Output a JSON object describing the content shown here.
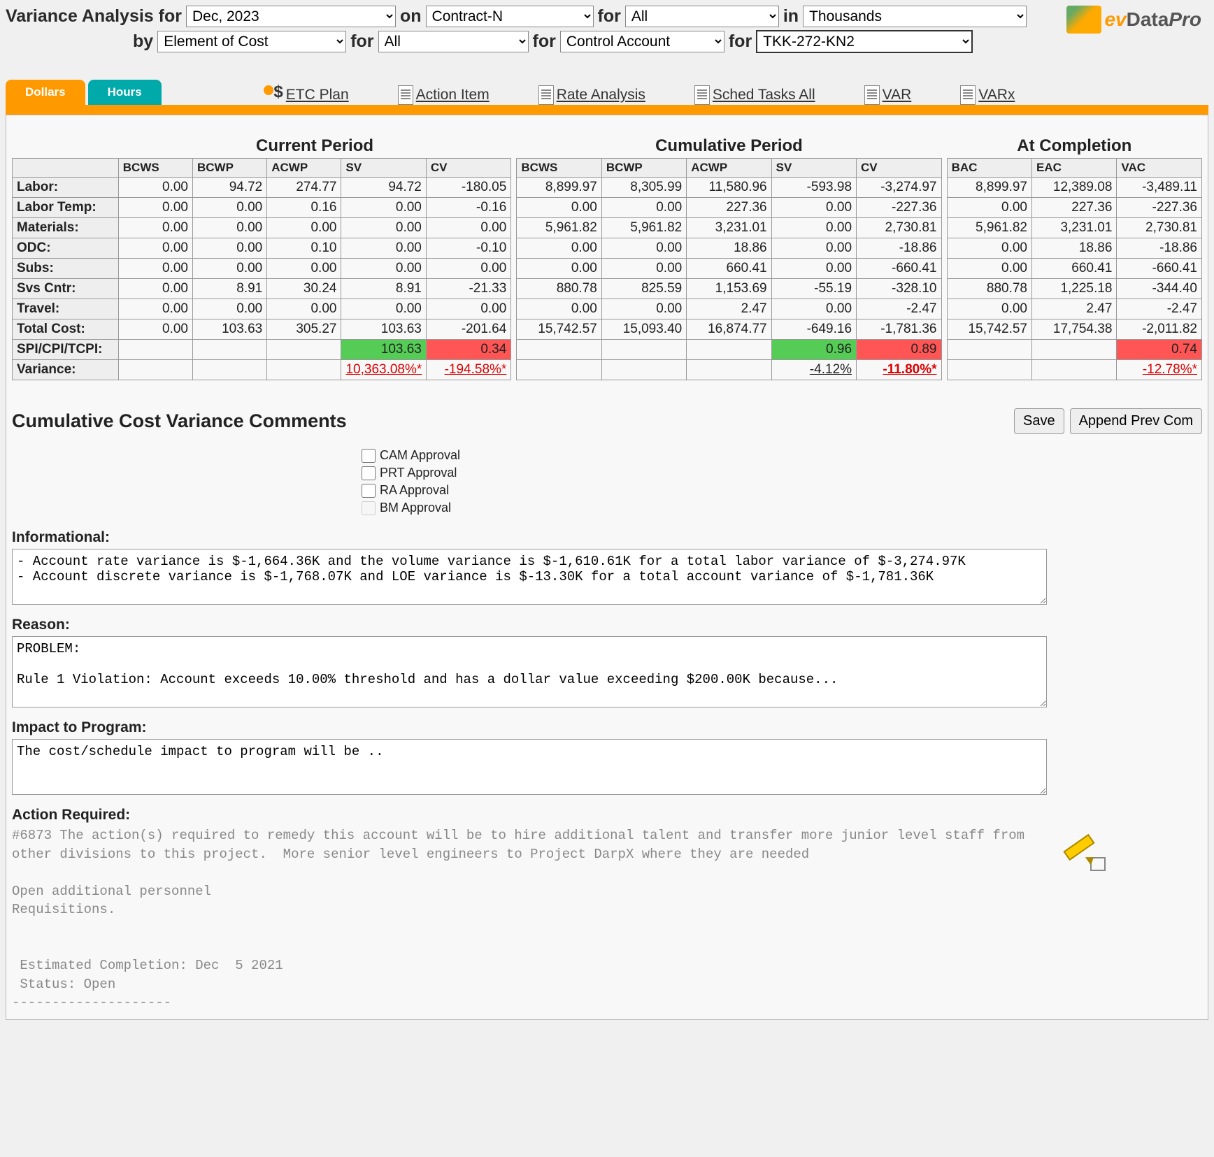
{
  "header": {
    "title_prefix": "Variance Analysis for",
    "month": "Dec, 2023",
    "on_lbl": "on",
    "contract": "Contract-N",
    "for1_lbl": "for",
    "all1": "All",
    "in_lbl": "in",
    "units": "Thousands",
    "by_lbl": "by",
    "eoc": "Element of Cost",
    "for2_lbl": "for",
    "all2": "All",
    "for3_lbl": "for",
    "ca": "Control Account",
    "for4_lbl": "for",
    "tkk": "TKK-272-KN2",
    "logo_ev": "ev",
    "logo_data": "Data ",
    "logo_pro": "Pro"
  },
  "tabs": {
    "dollars": "Dollars",
    "hours": "Hours"
  },
  "links": {
    "etc": "ETC Plan",
    "action": "Action Item",
    "rate": "Rate Analysis",
    "sched": "Sched Tasks All",
    "var": "VAR",
    "varx": "VARx"
  },
  "groups": {
    "cur": "Current Period",
    "cum": "Cumulative Period",
    "atc": "At Completion"
  },
  "cols": {
    "bcws": "BCWS",
    "bcwp": "BCWP",
    "acwp": "ACWP",
    "sv": "SV",
    "cv": "CV",
    "bac": "BAC",
    "eac": "EAC",
    "vac": "VAC"
  },
  "rows": [
    {
      "label": "Labor:",
      "cur": [
        "0.00",
        "94.72",
        "274.77",
        "94.72",
        "-180.05"
      ],
      "cum": [
        "8,899.97",
        "8,305.99",
        "11,580.96",
        "-593.98",
        "-3,274.97"
      ],
      "atc": [
        "8,899.97",
        "12,389.08",
        "-3,489.11"
      ]
    },
    {
      "label": "Labor Temp:",
      "cur": [
        "0.00",
        "0.00",
        "0.16",
        "0.00",
        "-0.16"
      ],
      "cum": [
        "0.00",
        "0.00",
        "227.36",
        "0.00",
        "-227.36"
      ],
      "atc": [
        "0.00",
        "227.36",
        "-227.36"
      ]
    },
    {
      "label": "Materials:",
      "cur": [
        "0.00",
        "0.00",
        "0.00",
        "0.00",
        "0.00"
      ],
      "cum": [
        "5,961.82",
        "5,961.82",
        "3,231.01",
        "0.00",
        "2,730.81"
      ],
      "atc": [
        "5,961.82",
        "3,231.01",
        "2,730.81"
      ]
    },
    {
      "label": "ODC:",
      "cur": [
        "0.00",
        "0.00",
        "0.10",
        "0.00",
        "-0.10"
      ],
      "cum": [
        "0.00",
        "0.00",
        "18.86",
        "0.00",
        "-18.86"
      ],
      "atc": [
        "0.00",
        "18.86",
        "-18.86"
      ]
    },
    {
      "label": "Subs:",
      "cur": [
        "0.00",
        "0.00",
        "0.00",
        "0.00",
        "0.00"
      ],
      "cum": [
        "0.00",
        "0.00",
        "660.41",
        "0.00",
        "-660.41"
      ],
      "atc": [
        "0.00",
        "660.41",
        "-660.41"
      ]
    },
    {
      "label": "Svs Cntr:",
      "cur": [
        "0.00",
        "8.91",
        "30.24",
        "8.91",
        "-21.33"
      ],
      "cum": [
        "880.78",
        "825.59",
        "1,153.69",
        "-55.19",
        "-328.10"
      ],
      "atc": [
        "880.78",
        "1,225.18",
        "-344.40"
      ]
    },
    {
      "label": "Travel:",
      "cur": [
        "0.00",
        "0.00",
        "0.00",
        "0.00",
        "0.00"
      ],
      "cum": [
        "0.00",
        "0.00",
        "2.47",
        "0.00",
        "-2.47"
      ],
      "atc": [
        "0.00",
        "2.47",
        "-2.47"
      ]
    },
    {
      "label": "Total Cost:",
      "cur": [
        "0.00",
        "103.63",
        "305.27",
        "103.63",
        "-201.64"
      ],
      "cum": [
        "15,742.57",
        "15,093.40",
        "16,874.77",
        "-649.16",
        "-1,781.36"
      ],
      "atc": [
        "15,742.57",
        "17,754.38",
        "-2,011.82"
      ]
    }
  ],
  "spi_row": {
    "label": "SPI/CPI/TCPI:",
    "cur": [
      "",
      "",
      "",
      "103.63",
      "0.34"
    ],
    "cum": [
      "",
      "",
      "",
      "0.96",
      "0.89"
    ],
    "atc": [
      "",
      "",
      "0.74"
    ]
  },
  "var_row": {
    "label": "Variance:",
    "cur": [
      "",
      "",
      "",
      "10,363.08%*",
      "-194.58%*"
    ],
    "cum": [
      "",
      "",
      "",
      "-4.12%",
      "-11.80%*"
    ],
    "atc": [
      "",
      "",
      "-12.78%*"
    ]
  },
  "comments": {
    "heading": "Cumulative Cost Variance Comments",
    "save": "Save",
    "append": "Append Prev Com",
    "approvals": {
      "cam": "CAM Approval",
      "prt": "PRT Approval",
      "ra": "RA Approval",
      "bm": "BM Approval"
    },
    "informational_lbl": "Informational:",
    "informational": "- Account rate variance is $-1,664.36K and the volume variance is $-1,610.61K for a total labor variance of $-3,274.97K\n- Account discrete variance is $-1,768.07K and LOE variance is $-13.30K for a total account variance of $-1,781.36K",
    "reason_lbl": "Reason:",
    "reason": "PROBLEM:\n\nRule 1 Violation: Account exceeds 10.00% threshold and has a dollar value exceeding $200.00K because...",
    "impact_lbl": "Impact to Program:",
    "impact": "The cost/schedule impact to program will be ..",
    "action_lbl": "Action Required:",
    "action": "#6873 The action(s) required to remedy this account will be to hire additional talent and transfer more junior level staff from other divisions to this project.  More senior level engineers to Project DarpX where they are needed\n\nOpen additional personnel\nRequisitions.\n\n\n Estimated Completion: Dec  5 2021\n Status: Open\n--------------------"
  }
}
